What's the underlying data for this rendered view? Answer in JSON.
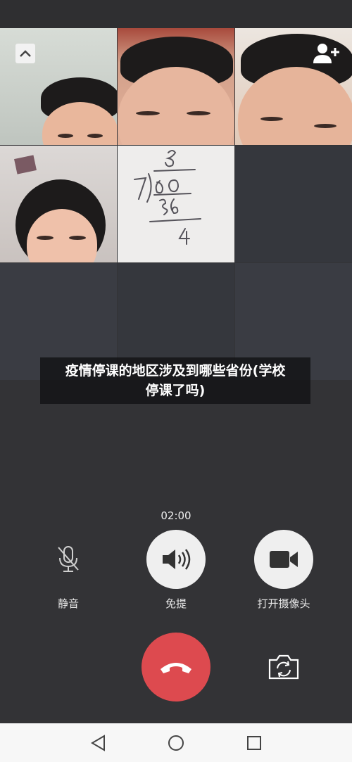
{
  "caption": {
    "line1": "疫情停课的地区涉及到哪些省份(学校",
    "line2": "停课了吗)"
  },
  "call": {
    "timer": "02:00"
  },
  "controls": {
    "mute_label": "静音",
    "speaker_label": "免提",
    "camera_label": "打开摄像头"
  },
  "icons": {
    "collapse": "chevron-up-icon",
    "add_user": "add-user-icon",
    "mute": "microphone-muted-icon",
    "speaker": "speaker-icon",
    "camera": "video-camera-icon",
    "hangup": "phone-hangup-icon",
    "switch_camera": "switch-camera-icon",
    "nav_back": "triangle-back-icon",
    "nav_home": "circle-home-icon",
    "nav_recent": "square-recent-icon"
  },
  "colors": {
    "hangup": "#dd4a4f",
    "background": "#333336",
    "navbar": "#f7f7f7"
  }
}
